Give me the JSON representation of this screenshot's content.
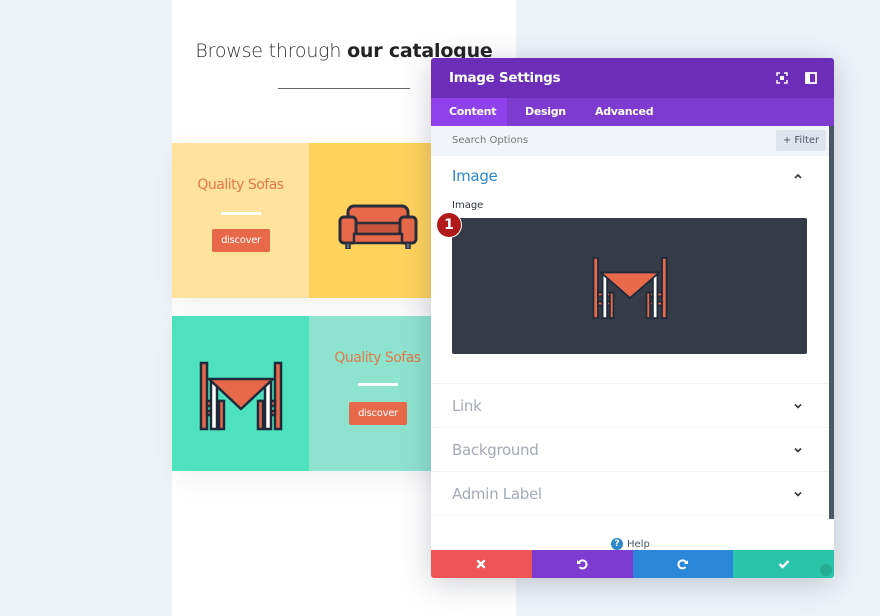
{
  "page": {
    "heading_light": "Browse through ",
    "heading_bold": "our catalogue",
    "rows": [
      {
        "title": "Quality Sofas",
        "button": "discover",
        "icon": "sofa-icon",
        "text_bg": "#ffe29c",
        "image_bg": "#ffd35c"
      },
      {
        "title": "Quality Sofas",
        "button": "discover",
        "icon": "dining-table-icon",
        "text_bg": "#8ee3cf",
        "image_bg": "#4de2bd"
      }
    ]
  },
  "modal": {
    "title": "Image Settings",
    "header_icons": [
      "expand-icon",
      "split-view-icon"
    ],
    "tabs": [
      {
        "label": "Content",
        "active": true
      },
      {
        "label": "Design",
        "active": false
      },
      {
        "label": "Advanced",
        "active": false
      }
    ],
    "search": {
      "placeholder": "Search Options"
    },
    "filter_label": "+ Filter",
    "sections": {
      "image": {
        "title": "Image",
        "expanded": true,
        "field_label": "Image",
        "badge": "1"
      },
      "link": {
        "title": "Link",
        "expanded": false
      },
      "background": {
        "title": "Background",
        "expanded": false
      },
      "admin_label": {
        "title": "Admin Label",
        "expanded": false
      }
    },
    "help_label": "Help",
    "footer": {
      "cancel": "close-icon",
      "undo": "undo-icon",
      "redo": "redo-icon",
      "save": "check-icon"
    },
    "colors": {
      "header": "#6c2eb9",
      "tabs": "#7e3bd0",
      "active_tab": "#8f42ec",
      "section_active": "#2b87c9",
      "cancel": "#ef5555",
      "undo": "#7e3bd0",
      "redo": "#2b87da",
      "save": "#29c4a9"
    }
  }
}
